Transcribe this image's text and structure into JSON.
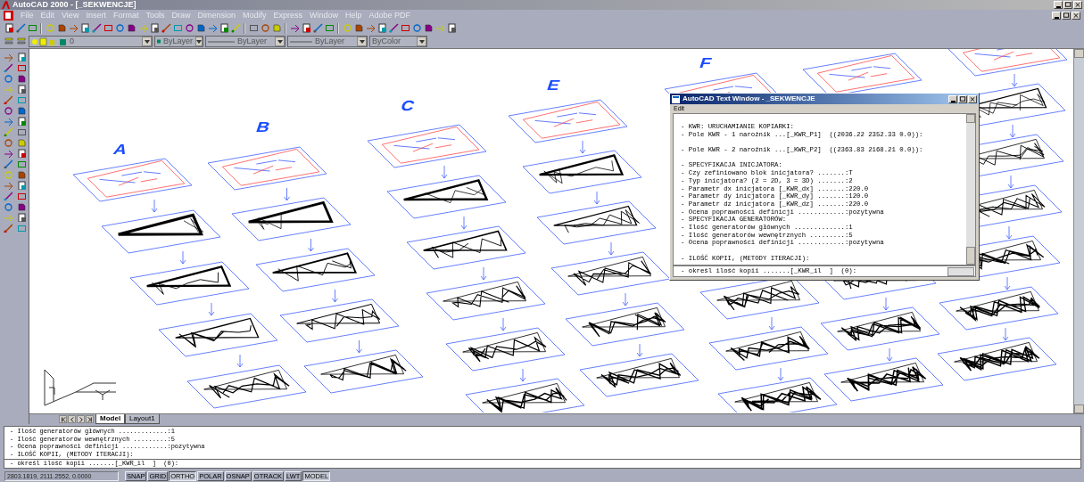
{
  "window": {
    "title": "AutoCAD 2000 - [_SEKWENCJE]"
  },
  "menu": [
    "File",
    "Edit",
    "View",
    "Insert",
    "Format",
    "Tools",
    "Draw",
    "Dimension",
    "Modify",
    "Express",
    "Window",
    "Help",
    "Adobe PDF"
  ],
  "properties_bar": {
    "layer": "0",
    "color_setting": "ByLayer",
    "linetype": "ByLayer",
    "lineweight": "ByLayer",
    "plot_style": "ByColor"
  },
  "canvas_labels": [
    "A",
    "B",
    "C",
    "E",
    "F"
  ],
  "layout_tabs": [
    {
      "label": "Model",
      "selected": true
    },
    {
      "label": "Layout1",
      "selected": false
    }
  ],
  "text_window": {
    "title": "AutoCAD Text Window - _SEKWENCJE",
    "menu": [
      "Edit"
    ],
    "blocks": [
      [
        "- KWR: URUCHAMIANIE KOPIARKI:",
        "- Pole KWR - 1 narożnik ...[_KWR_P1]  ((2036.22 2352.33 0.0)):"
      ],
      [
        "- Pole KWR - 2 narożnik ...[_KWR_P2]  ((2363.83 2168.21 0.0)):"
      ],
      [
        "- SPECYFIKACJA INICJATORA:",
        "- Czy zefiniowano blok inicjatora? .......:T",
        "- Typ inicjatora? (2 = 2D, 3 = 3D) .......:2",
        "- Parametr dx inicjatora [_KWR_dx] .......:220.0",
        "- Parametr dy inicjatora [_KWR_dy] .......:120.0",
        "- Parametr dz inicjatora [_KWR_dz] .......:220.0",
        "- Ocena poprawności definicji ............:pozytywna",
        "- SPECYFIKACJA GENERATORÓW:",
        "- Ilość generatorów głównych .............:1",
        "- Ilość generatorów wewnętrznych .........:5",
        "- Ocena poprawności definicji ............:pozytywna"
      ],
      [
        "- ILOŚĆ KOPII, (METODY ITERACJI):"
      ]
    ],
    "input": "- określ ilość kopii .......[_KWR_il  ]  (0):"
  },
  "command_history": [
    "- Ilość generatorów głównych .............:1",
    "- Ilość generatorów wewnętrznych .........:5",
    "- Ocena poprawności definicji ............:pozytywna",
    "- ILOŚĆ KOPII, (METODY ITERACJI):"
  ],
  "command_input": "- określ ilość kopii .......[_KWR_il  ]  (0):",
  "status_bar": {
    "coordinates": "2803.1819, 2111.2552, 0.0000",
    "toggles": [
      {
        "label": "SNAP",
        "on": false
      },
      {
        "label": "GRID",
        "on": false
      },
      {
        "label": "ORTHO",
        "on": true
      },
      {
        "label": "POLAR",
        "on": false
      },
      {
        "label": "OSNAP",
        "on": false
      },
      {
        "label": "OTRACK",
        "on": false
      },
      {
        "label": "LWT",
        "on": false
      },
      {
        "label": "MODEL",
        "on": true
      }
    ]
  }
}
